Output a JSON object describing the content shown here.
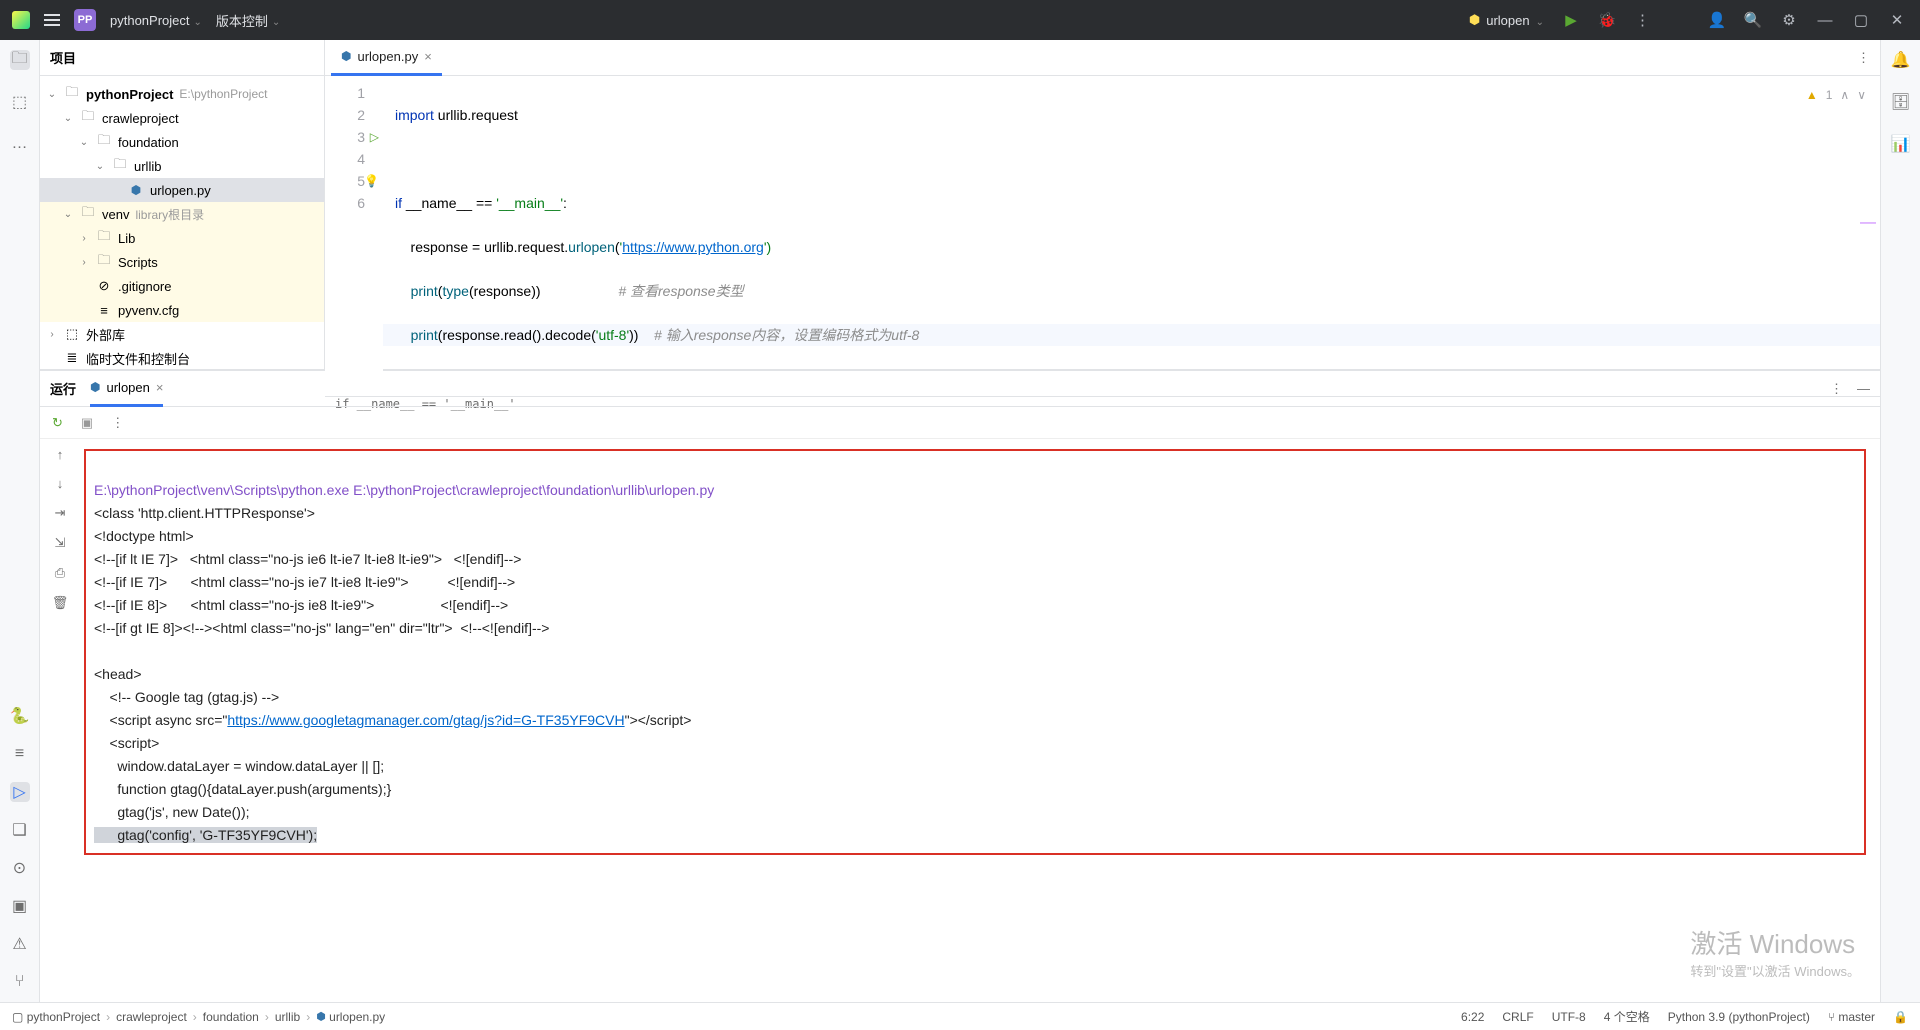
{
  "titlebar": {
    "project_badge": "PP",
    "project_name": "pythonProject",
    "vcs_label": "版本控制",
    "run_config": "urlopen"
  },
  "project": {
    "header": "项目",
    "root_name": "pythonProject",
    "root_path": "E:\\pythonProject",
    "nodes": {
      "crawleproject": "crawleproject",
      "foundation": "foundation",
      "urllib": "urllib",
      "urlopen": "urlopen.py",
      "venv": "venv",
      "venv_note": "library根目录",
      "lib": "Lib",
      "scripts": "Scripts",
      "gitignore": ".gitignore",
      "pyvenv": "pyvenv.cfg",
      "ext_lib": "外部库",
      "scratch": "临时文件和控制台"
    }
  },
  "editor": {
    "tab_name": "urlopen.py",
    "warning_count": "1",
    "breadcrumb": "if __name__ == '__main__'",
    "code": {
      "l1_kw": "import",
      "l1_rest": " urllib.request",
      "l3_a": "if",
      "l3_b": " __name__ == ",
      "l3_c": "'__main__'",
      "l3_d": ":",
      "l4_a": "    response = urllib.request.",
      "l4_fn": "urlopen",
      "l4_b": "(",
      "l4_c": "'",
      "l4_url": "https://www.python.org",
      "l4_d": "')",
      "l5_a": "    ",
      "l5_fn": "print",
      "l5_b": "(",
      "l5_fn2": "type",
      "l5_c": "(response))",
      "l5_cm": "# 查看response类型",
      "l6_a": "    ",
      "l6_fn": "print",
      "l6_b": "(response.read().decode(",
      "l6_c": "'utf-8'",
      "l6_d": "))",
      "l6_cm": "# 输入response内容，设置编码格式为utf-8"
    }
  },
  "run": {
    "label": "运行",
    "tab": "urlopen",
    "output": {
      "cmd": "E:\\pythonProject\\venv\\Scripts\\python.exe E:\\pythonProject\\crawleproject\\foundation\\urllib\\urlopen.py",
      "l2": "<class 'http.client.HTTPResponse'>",
      "l3": "<!doctype html>",
      "l4": "<!--[if lt IE 7]>   <html class=\"no-js ie6 lt-ie7 lt-ie8 lt-ie9\">   <![endif]-->",
      "l5": "<!--[if IE 7]>      <html class=\"no-js ie7 lt-ie8 lt-ie9\">          <![endif]-->",
      "l6": "<!--[if IE 8]>      <html class=\"no-js ie8 lt-ie9\">                 <![endif]-->",
      "l7": "<!--[if gt IE 8]><!--><html class=\"no-js\" lang=\"en\" dir=\"ltr\">  <!--<![endif]-->",
      "l8": "",
      "l9": "<head>",
      "l10": "    <!-- Google tag (gtag.js) -->",
      "l11a": "    <script async src=\"",
      "l11url": "https://www.googletagmanager.com/gtag/js?id=G-TF35YF9CVH",
      "l11b": "\"></script>",
      "l12": "    <script>",
      "l13": "      window.dataLayer = window.dataLayer || [];",
      "l14": "      function gtag(){dataLayer.push(arguments);}",
      "l15": "      gtag('js', new Date());",
      "l16": "      gtag('config', 'G-TF35YF9CVH');"
    }
  },
  "status": {
    "crumbs": [
      "pythonProject",
      "crawleproject",
      "foundation",
      "urllib",
      "urlopen.py"
    ],
    "pos": "6:22",
    "eol": "CRLF",
    "enc": "UTF-8",
    "indent": "4 个空格",
    "interp": "Python 3.9 (pythonProject)",
    "branch": "master"
  },
  "watermark": {
    "big": "激活 Windows",
    "small": "转到\"设置\"以激活 Windows。"
  }
}
